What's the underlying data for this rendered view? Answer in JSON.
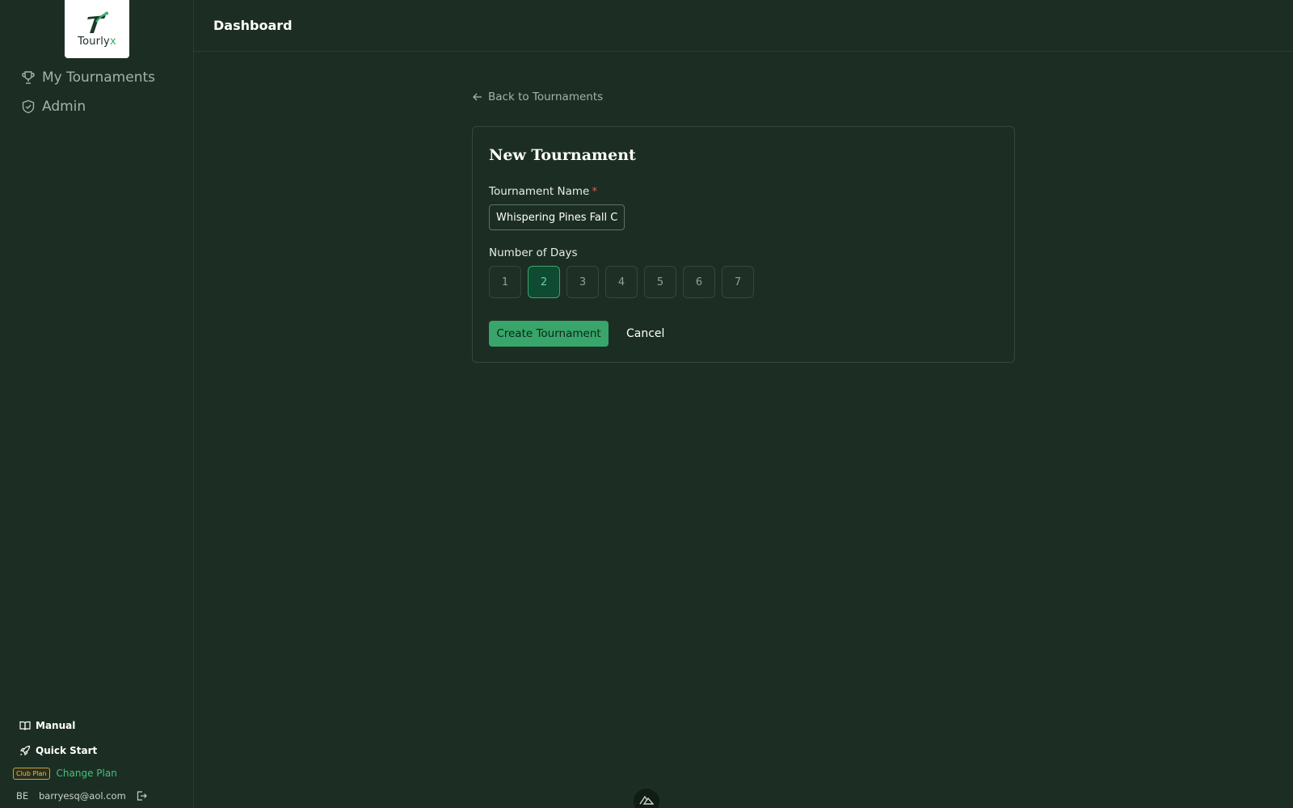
{
  "app": {
    "logo_text_main": "Tourly",
    "logo_text_accent": "x"
  },
  "sidebar": {
    "items": [
      {
        "label": "My Tournaments",
        "icon": "trophy-icon"
      },
      {
        "label": "Admin",
        "icon": "shield-icon"
      }
    ],
    "bottom_links": [
      {
        "label": "Manual",
        "icon": "book-icon"
      },
      {
        "label": "Quick Start",
        "icon": "rocket-icon"
      }
    ],
    "plan_badge": "Club Plan",
    "change_plan_label": "Change Plan",
    "user_initials": "BE",
    "user_email": "barryesq@aol.com"
  },
  "header": {
    "title": "Dashboard"
  },
  "main": {
    "back_label": "Back to Tournaments",
    "form": {
      "title": "New Tournament",
      "name_label": "Tournament Name",
      "required_marker": "*",
      "name_value": "Whispering Pines Fall C",
      "days_label": "Number of Days",
      "days_options": [
        "1",
        "2",
        "3",
        "4",
        "5",
        "6",
        "7"
      ],
      "days_selected": "2",
      "create_label": "Create Tournament",
      "cancel_label": "Cancel"
    }
  },
  "colors": {
    "background": "#1c2e23",
    "accent": "#38a56a",
    "selected_day_bg": "#0f4a32",
    "required": "#e05a4f",
    "plan_badge": "#e8c04a"
  }
}
